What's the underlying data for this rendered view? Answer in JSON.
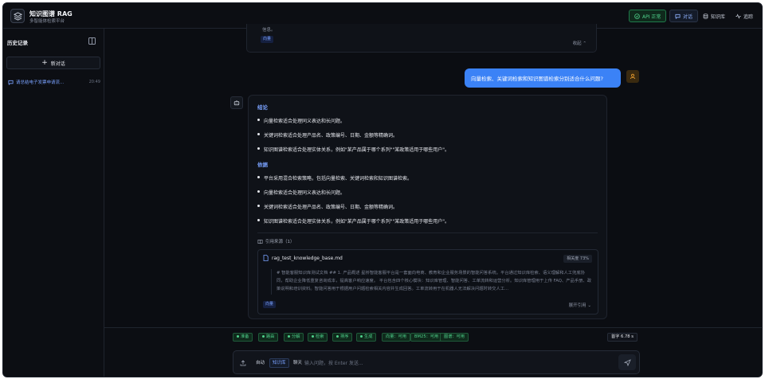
{
  "header": {
    "title": "知识图谱 RAG",
    "subtitle": "多智能体检索平台",
    "api_label": "API 正常",
    "chat_label": "对话",
    "kb_label": "知识库",
    "trace_label": "追踪"
  },
  "sidebar": {
    "title": "历史记录",
    "new_chat": "新对话",
    "items": [
      {
        "label": "请总结电子发票申请流...",
        "time": "20:49"
      }
    ]
  },
  "previous": {
    "text": "信息。",
    "tag": "向量",
    "collapse": "收起"
  },
  "user_message": "向量检索、关键词检索和知识图谱检索分别适合什么问题?",
  "answer": {
    "conclusion_title": "结论",
    "conclusion": [
      "向量检索适合处理同义表达和长问题。",
      "关键词检索适合处理产品名、政策编号、日期、金额等精确词。",
      "知识图谱检索适合处理实体关系，例如\"某产品属于哪个系列\"\"某政策适用于哪些用户\"。"
    ],
    "basis_title": "依据",
    "basis": [
      "平台采用混合检索策略，包括向量检索、关键词检索和知识图谱检索。",
      "向量检索适合处理同义表达和长问题。",
      "关键词检索适合处理产品名、政策编号、日期、金额等精确词。",
      "知识图谱检索适合处理实体关系，例如\"某产品属于哪个系列\"\"某政策适用于哪些用户\"。"
    ],
    "refs_label": "引用来源（1）",
    "ref": {
      "file": "rag_test_knowledge_base.md",
      "score": "相关度 73%",
      "text": "# 智能客服知识库测试文档 ## 1. 产品概述 星桥智能客服平台是一套面向电商、教育和企业服务场景的智能问答系统。平台通过知识库检索、语义理解和人工兜底协同，帮助企业降低重复咨询成本，提高客户响应速度。 平台包含四个核心模块：知识库管理、智能问答、工单流转和运营分析。知识库管理用于上传 FAQ、产品手册、政策说明和培训资料。智能问答用于根据用户问题检索相关内容并生成回答。工单流转用于在机器人无法解决问题时转交人工...",
      "tag": "向量",
      "expand": "展开引用"
    }
  },
  "pipeline": [
    "准备",
    "路由",
    "分解",
    "检索",
    "排序",
    "生成",
    "向量：可用",
    "BM25：可用",
    "图谱：可用"
  ],
  "first_token": "首字 6.78 s",
  "input": {
    "modes": [
      "自动",
      "知识库",
      "聊天"
    ],
    "active_mode": "知识库",
    "placeholder": "输入问题，按 Enter 发送..."
  },
  "colors": {
    "accent": "#3b82f6",
    "success": "#4fd18b",
    "background": "#0b0d12"
  }
}
